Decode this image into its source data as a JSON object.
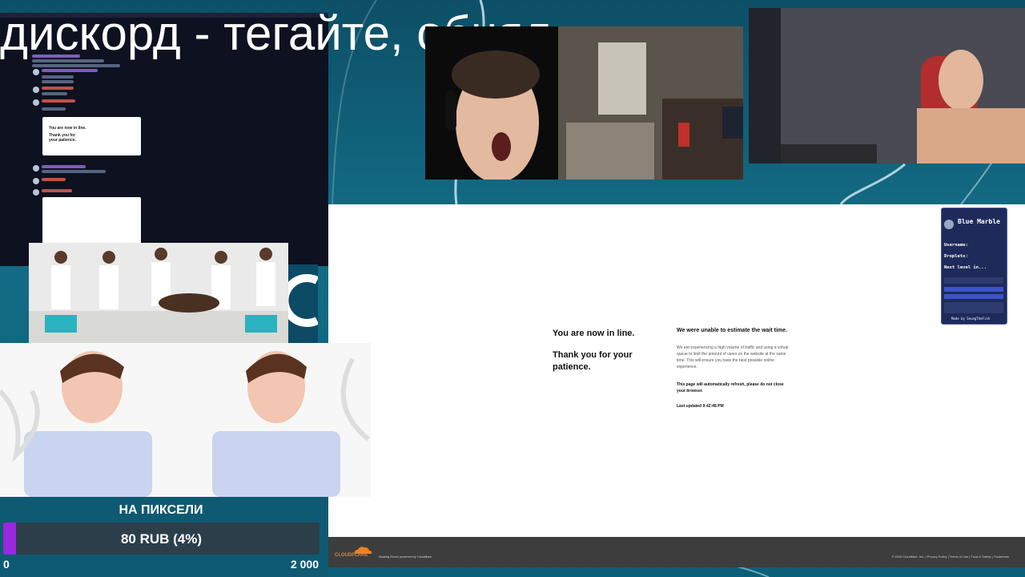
{
  "overlay": {
    "title": "дискорд  - тегайте, обнял"
  },
  "discord_preview": {
    "card1": {
      "left_1": "You are now in line.",
      "left_2": "Thank you for your patience."
    }
  },
  "queue_page": {
    "left_heading": "You are now in line.",
    "left_sub": "Thank you for your patience.",
    "right_heading": "We were unable to estimate the wait time.",
    "right_paragraph": "We are experiencing a high volume of traffic and using a virtual queue to limit the amount of users on the website at the same time. This will ensure you have the best possible online experience.",
    "right_bold": "This page will automatically refresh, please do not close your browser.",
    "last_updated": "Last updated 9:42:48 PM",
    "footer_logo": "CLOUDFLARE",
    "footer_powered": "Waiting Room powered by Cloudflare",
    "footer_legal": "© 2025 Cloudflare, Inc. | Privacy Policy | Terms of Use | Trust & Safety | Trademark"
  },
  "widget": {
    "title": "Blue Marble",
    "username_label": "Username:",
    "droplets_label": "Droplets:",
    "next_level_label": "Next level in...",
    "footer": "Made by SeungTheFish"
  },
  "donation_goal": {
    "title": "НА ПИКСЕЛИ",
    "value_text": "80 RUB (4%)",
    "progress_fraction": 0.04,
    "min": "0",
    "max": "2 000",
    "bar_color": "#9b27e0"
  }
}
